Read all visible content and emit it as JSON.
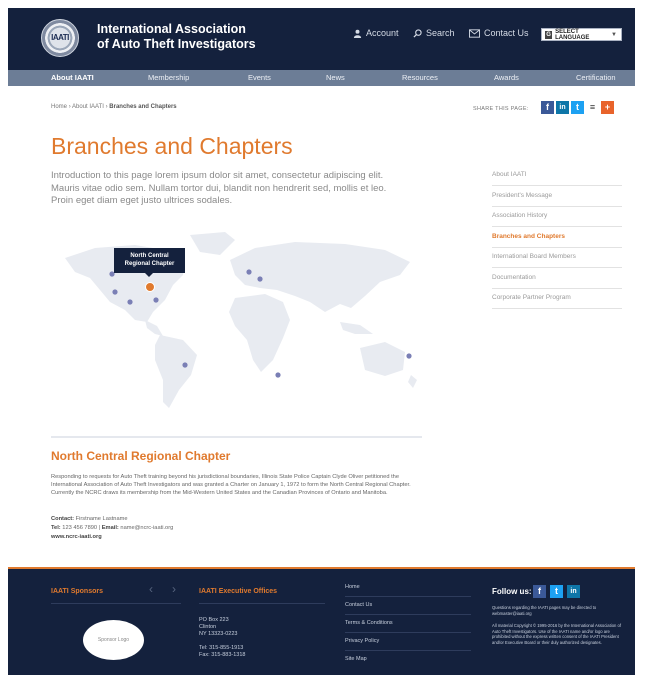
{
  "header": {
    "org_name_line1": "International Association",
    "org_name_line2": "of Auto Theft Investigators",
    "seal_text": "IAATI",
    "links": [
      {
        "label": "Account",
        "icon": "user-icon"
      },
      {
        "label": "Search",
        "icon": "search-icon"
      },
      {
        "label": "Contact Us",
        "icon": "mail-icon"
      }
    ],
    "language_button": "SELECT LANGUAGE"
  },
  "nav": {
    "items": [
      "About IAATI",
      "Membership",
      "Events",
      "News",
      "Resources",
      "Awards",
      "Certification"
    ]
  },
  "breadcrumb": {
    "home": "Home",
    "parent": "About IAATI",
    "separator": "›",
    "current": "Branches and Chapters"
  },
  "share": {
    "label": "SHARE THIS PAGE:",
    "buttons": [
      {
        "icon": "facebook-icon",
        "glyph": "f",
        "color": "#3b5998"
      },
      {
        "icon": "linkedin-icon",
        "glyph": "in",
        "color": "#0e76a8"
      },
      {
        "icon": "twitter-icon",
        "glyph": "t",
        "color": "#1da1f2"
      },
      {
        "icon": "layers-icon",
        "glyph": "≡",
        "color": "#333333"
      },
      {
        "icon": "add-icon",
        "glyph": "+",
        "color": "#e8632b"
      }
    ]
  },
  "page": {
    "title": "Branches and Chapters",
    "intro": "Introduction to this page lorem ipsum dolor sit amet, consectetur adipiscing elit. Mauris vitae odio sem. Nullam tortor dui, blandit non hendrerit sed, mollis et leo. Proin eget diam eget justo ultrices sodales."
  },
  "sidebar": {
    "items": [
      {
        "label": "About IAATI",
        "active": false
      },
      {
        "label": "President's Message",
        "active": false
      },
      {
        "label": "Association History",
        "active": false
      },
      {
        "label": "Branches and Chapters",
        "active": true
      },
      {
        "label": "International Board Members",
        "active": false
      },
      {
        "label": "Documentation",
        "active": false
      },
      {
        "label": "Corporate Partner Program",
        "active": false
      }
    ]
  },
  "map": {
    "tooltip_line1": "North Central",
    "tooltip_line2": "Regional Chapter",
    "marker_color": "#7a7fb5",
    "active_marker_color": "#e07a2e"
  },
  "chapter": {
    "title": "North Central Regional Chapter",
    "body": "Responding to requests for Auto Theft training beyond his jurisdictional boundaries, Illinois State Police Captain Clyde Oliver petitioned the International Association of Auto Theft Investigators and was granted a Charter on January 1, 1972 to form the North Central Regional Chapter. Currently the NCRC draws its membership from the Mid-Western United States and the Canadian Provinces of Ontario and Manitoba.",
    "contact_label": "Contact:",
    "contact_name": "Firstname Lastname",
    "tel_label": "Tel:",
    "tel_value": "123 456 7890",
    "email_label": "Email:",
    "email_value": "name@ncrc-iaati.org",
    "website": "www.ncrc-iaati.org"
  },
  "footer": {
    "sponsors_heading": "IAATI Sponsors",
    "sponsor_logo": "Sponsor Logo",
    "offices_heading": "IAATI Executive Offices",
    "address_line1": "PO Box 223",
    "address_line2": "Clinton",
    "address_line3": "NY 13323-0223",
    "tel": "Tel: 315-855-1913",
    "fax": "Fax: 315-883-1318",
    "links": [
      "Home",
      "Contact Us",
      "Terms & Conditions",
      "Privacy Policy",
      "Site Map"
    ],
    "follow_label": "Follow us:",
    "social": [
      {
        "icon": "facebook-icon",
        "glyph": "f",
        "color": "#3b5998"
      },
      {
        "icon": "twitter-icon",
        "glyph": "t",
        "color": "#1da1f2"
      },
      {
        "icon": "linkedin-icon",
        "glyph": "in",
        "color": "#0e76a8"
      }
    ],
    "questions": "Questions regarding the IAATI pages may be directed to webmaster@iaati.org",
    "copyright": "All material Copyright © 1995-2016 by the International Association of Auto Theft Investigators. Use of the IAATI name and/or logo are prohibited without the express written consent of the IAATI President and/or Executive Board or their duly authorized designates."
  }
}
